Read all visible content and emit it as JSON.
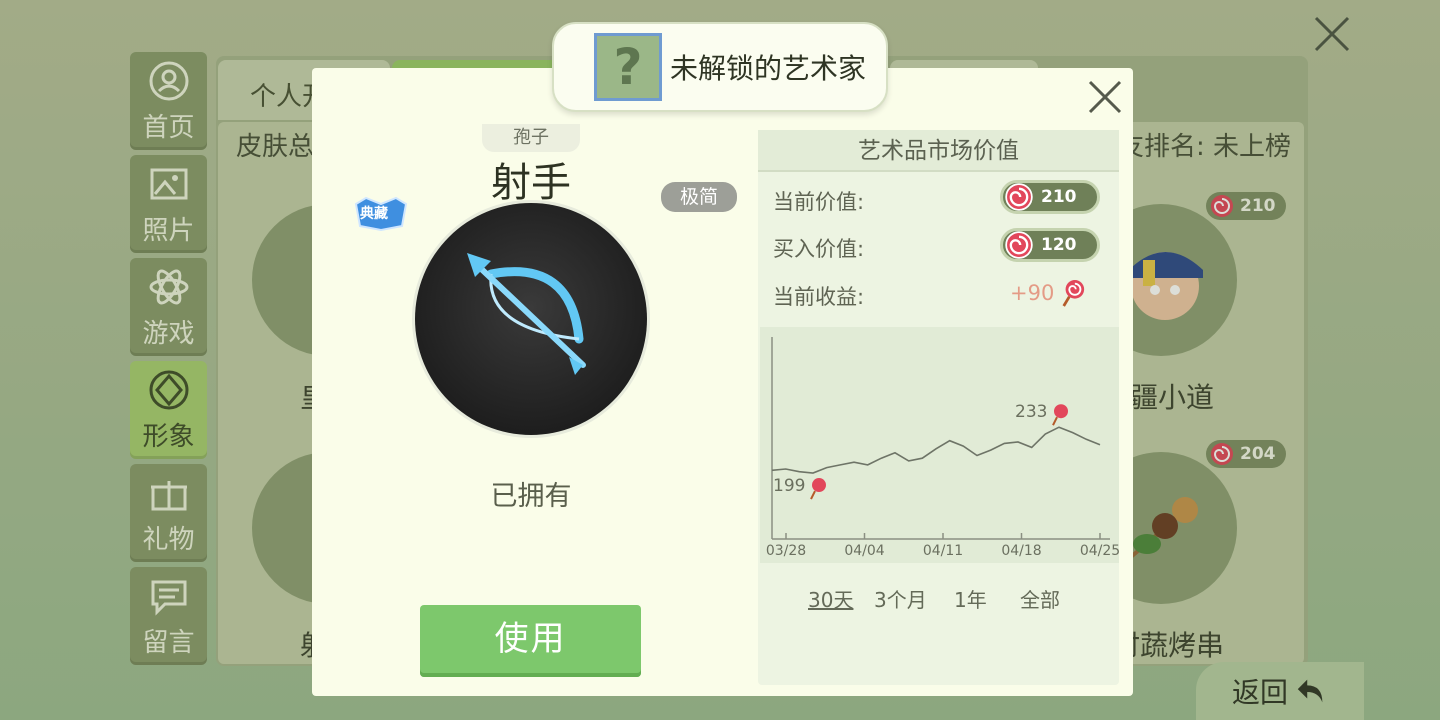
{
  "background": {
    "sidebar": [
      {
        "label": "首页",
        "icon": "home-icon"
      },
      {
        "label": "照片",
        "icon": "photo-icon"
      },
      {
        "label": "游戏",
        "icon": "game-icon"
      },
      {
        "label": "形象",
        "icon": "avatar-icon",
        "active": true
      },
      {
        "label": "礼物",
        "icon": "gift-icon"
      },
      {
        "label": "留言",
        "icon": "message-icon"
      }
    ],
    "tab_personal": "个人开",
    "skin_total": "皮肤总",
    "rank_text": "友排名: 未上榜",
    "items": [
      {
        "name_partial": "皇",
        "name": "疆小道",
        "price": "210"
      },
      {
        "name_partial": "射",
        "name": "时蔬烤串",
        "price": "204"
      }
    ],
    "back_label": "返回"
  },
  "modal": {
    "title": "未解锁的艺术家",
    "question_mark": "?",
    "category": "孢子",
    "skin_name": "射手",
    "badge_simple": "极简",
    "badge_classic": "典藏",
    "owned_label": "已拥有",
    "use_button": "使用",
    "market": {
      "header": "艺术品市场价值",
      "current_label": "当前价值:",
      "current_value": "210",
      "buy_label": "买入价值:",
      "buy_value": "120",
      "profit_label": "当前收益:",
      "profit_value": "+90",
      "ranges": [
        "30天",
        "3个月",
        "1年",
        "全部"
      ],
      "selected_range": "30天"
    }
  },
  "chart_data": {
    "type": "line",
    "x_ticks": [
      "03/28",
      "04/04",
      "04/11",
      "04/18",
      "04/25"
    ],
    "series": [
      {
        "values": [
          201,
          202,
          200,
          199,
          203,
          205,
          207,
          205,
          210,
          214,
          208,
          210,
          217,
          223,
          219,
          212,
          216,
          221,
          222,
          218,
          228,
          233,
          229,
          224,
          220
        ]
      }
    ],
    "annotations": [
      {
        "label": "199",
        "index": 3,
        "value": 199
      },
      {
        "label": "233",
        "index": 21,
        "value": 233
      }
    ],
    "ylim": [
      150,
      300
    ]
  },
  "colors": {
    "accent_green": "#7dc86c",
    "candy_red": "#e2475b",
    "profit_text": "#e49b86"
  }
}
